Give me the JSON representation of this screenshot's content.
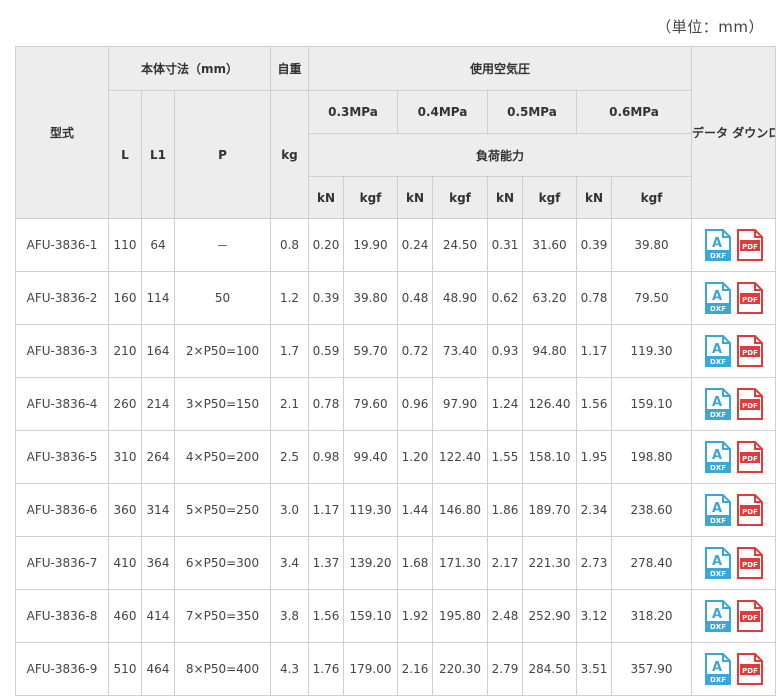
{
  "unit_note": "（単位：mm）",
  "headers": {
    "model": "型式",
    "body_dims": "本体寸法（mm）",
    "weight": "自重",
    "pressure": "使用空気圧",
    "download": "データ ダウンロード（DXF/PDF）",
    "load_capacity": "負荷能力",
    "L": "L",
    "L1": "L1",
    "P": "P",
    "kg": "kg",
    "pressures": [
      "0.3MPa",
      "0.4MPa",
      "0.5MPa",
      "0.6MPa"
    ],
    "kN": "kN",
    "kgf": "kgf"
  },
  "icons": {
    "dxf": "dxf-file-icon",
    "pdf": "pdf-file-icon",
    "dxf_text": "DXF",
    "pdf_text": "PDF",
    "dxf_letter": "A"
  },
  "colors": {
    "dxf": "#3aa7d6",
    "pdf": "#e03a3a",
    "header_bg": "#ededed",
    "border": "#cfcfcf"
  },
  "rows": [
    {
      "model": "AFU-3836-1",
      "L": "110",
      "L1": "64",
      "P": "－",
      "kg": "0.8",
      "v": [
        "0.20",
        "19.90",
        "0.24",
        "24.50",
        "0.31",
        "31.60",
        "0.39",
        "39.80"
      ]
    },
    {
      "model": "AFU-3836-2",
      "L": "160",
      "L1": "114",
      "P": "50",
      "kg": "1.2",
      "v": [
        "0.39",
        "39.80",
        "0.48",
        "48.90",
        "0.62",
        "63.20",
        "0.78",
        "79.50"
      ]
    },
    {
      "model": "AFU-3836-3",
      "L": "210",
      "L1": "164",
      "P": "2×P50=100",
      "kg": "1.7",
      "v": [
        "0.59",
        "59.70",
        "0.72",
        "73.40",
        "0.93",
        "94.80",
        "1.17",
        "119.30"
      ]
    },
    {
      "model": "AFU-3836-4",
      "L": "260",
      "L1": "214",
      "P": "3×P50=150",
      "kg": "2.1",
      "v": [
        "0.78",
        "79.60",
        "0.96",
        "97.90",
        "1.24",
        "126.40",
        "1.56",
        "159.10"
      ]
    },
    {
      "model": "AFU-3836-5",
      "L": "310",
      "L1": "264",
      "P": "4×P50=200",
      "kg": "2.5",
      "v": [
        "0.98",
        "99.40",
        "1.20",
        "122.40",
        "1.55",
        "158.10",
        "1.95",
        "198.80"
      ]
    },
    {
      "model": "AFU-3836-6",
      "L": "360",
      "L1": "314",
      "P": "5×P50=250",
      "kg": "3.0",
      "v": [
        "1.17",
        "119.30",
        "1.44",
        "146.80",
        "1.86",
        "189.70",
        "2.34",
        "238.60"
      ]
    },
    {
      "model": "AFU-3836-7",
      "L": "410",
      "L1": "364",
      "P": "6×P50=300",
      "kg": "3.4",
      "v": [
        "1.37",
        "139.20",
        "1.68",
        "171.30",
        "2.17",
        "221.30",
        "2.73",
        "278.40"
      ]
    },
    {
      "model": "AFU-3836-8",
      "L": "460",
      "L1": "414",
      "P": "7×P50=350",
      "kg": "3.8",
      "v": [
        "1.56",
        "159.10",
        "1.92",
        "195.80",
        "2.48",
        "252.90",
        "3.12",
        "318.20"
      ]
    },
    {
      "model": "AFU-3836-9",
      "L": "510",
      "L1": "464",
      "P": "8×P50=400",
      "kg": "4.3",
      "v": [
        "1.76",
        "179.00",
        "2.16",
        "220.30",
        "2.79",
        "284.50",
        "3.51",
        "357.90"
      ]
    }
  ]
}
